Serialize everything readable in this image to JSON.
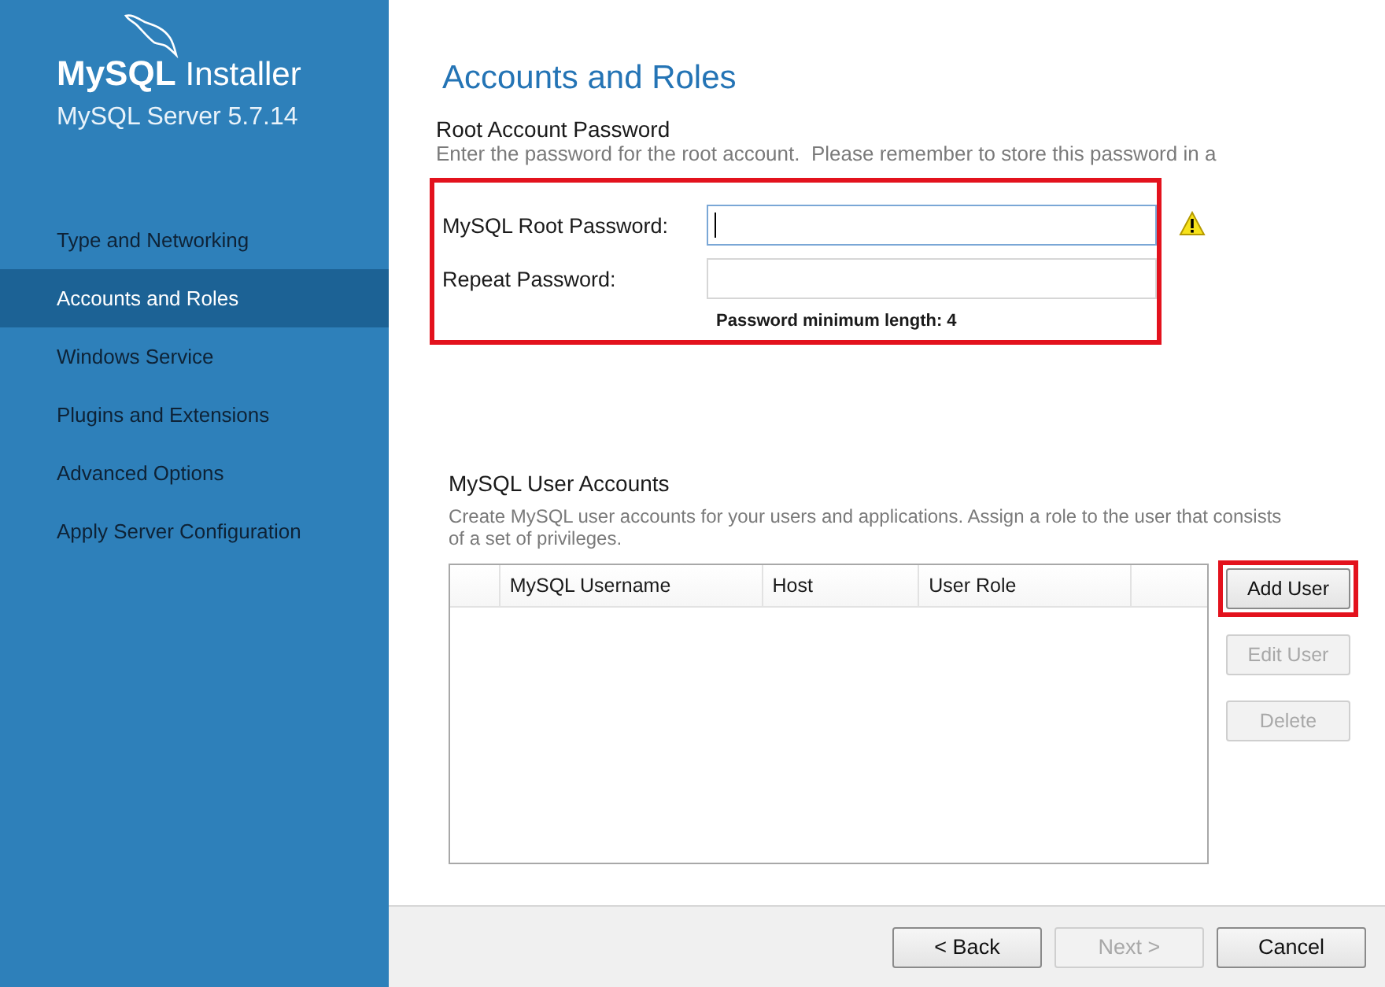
{
  "sidebar": {
    "product": "MySQL",
    "product_suffix": "Installer",
    "subtitle": "MySQL Server 5.7.14",
    "items": [
      {
        "label": "Type and Networking",
        "selected": false
      },
      {
        "label": "Accounts and Roles",
        "selected": true
      },
      {
        "label": "Windows Service",
        "selected": false
      },
      {
        "label": "Plugins and Extensions",
        "selected": false
      },
      {
        "label": "Advanced Options",
        "selected": false
      },
      {
        "label": "Apply Server Configuration",
        "selected": false
      }
    ]
  },
  "page_title": "Accounts and Roles",
  "root_password": {
    "heading": "Root Account Password",
    "description": "Enter the password for the root account.  Please remember to store this password in a",
    "highlighted": true,
    "fields": [
      {
        "label": "MySQL Root Password:",
        "focused": true,
        "warning": true
      },
      {
        "label": "Repeat Password:",
        "focused": false,
        "warning": false
      }
    ],
    "hint": "Password minimum length: 4"
  },
  "user_accounts": {
    "heading": "MySQL User Accounts",
    "description": "Create MySQL user accounts for your users and applications. Assign a role to the user that consists of a set of privileges.",
    "columns": [
      "MySQL Username",
      "Host",
      "User Role"
    ],
    "buttons": [
      {
        "label": "Add User",
        "disabled": false,
        "highlighted": true
      },
      {
        "label": "Edit User",
        "disabled": true,
        "highlighted": false
      },
      {
        "label": "Delete",
        "disabled": true,
        "highlighted": false
      }
    ]
  },
  "footer_buttons": [
    {
      "label": "< Back",
      "disabled": false
    },
    {
      "label": "Next >",
      "disabled": true
    },
    {
      "label": "Cancel",
      "disabled": false
    }
  ]
}
